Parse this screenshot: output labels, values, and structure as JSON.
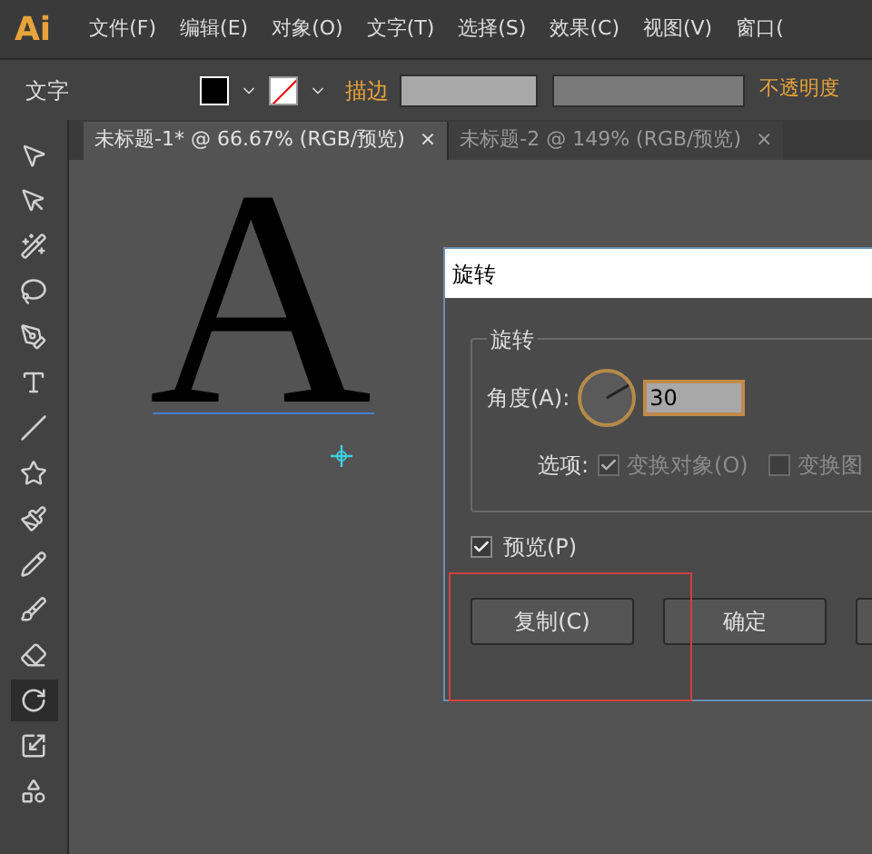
{
  "app": {
    "logo": "Ai"
  },
  "menu": [
    "文件(F)",
    "编辑(E)",
    "对象(O)",
    "文字(T)",
    "选择(S)",
    "效果(C)",
    "视图(V)",
    "窗口("
  ],
  "control_bar": {
    "label": "文字",
    "stroke_label": "描边",
    "opacity_label": "不透明度"
  },
  "tabs": [
    {
      "label": "未标题-1* @ 66.67% (RGB/预览)",
      "close": "×",
      "selected": true
    },
    {
      "label": "未标题-2 @ 149% (RGB/预览)",
      "close": "×",
      "selected": false
    }
  ],
  "tools": [
    {
      "selected": false
    },
    {
      "selected": false
    },
    {
      "selected": false
    },
    {
      "selected": false
    },
    {
      "selected": false
    },
    {
      "selected": false
    },
    {
      "selected": false
    },
    {
      "selected": false
    },
    {
      "selected": false
    },
    {
      "selected": false
    },
    {
      "selected": false
    },
    {
      "selected": false
    },
    {
      "selected": true
    },
    {
      "selected": false
    },
    {
      "selected": false
    }
  ],
  "canvas": {
    "glyph": "A"
  },
  "dialog": {
    "title": "旋转",
    "group_title": "旋转",
    "angle_label": "角度(A):",
    "angle_value": "30",
    "options_label": "选项:",
    "options": [
      {
        "label": "变换对象(O)",
        "checked": true,
        "disabled": true
      },
      {
        "label": "变换图",
        "checked": false,
        "disabled": true
      }
    ],
    "preview": {
      "label": "预览(P)",
      "checked": true
    },
    "buttons": [
      {
        "label": "复制(C)"
      },
      {
        "label": "确定"
      }
    ]
  }
}
